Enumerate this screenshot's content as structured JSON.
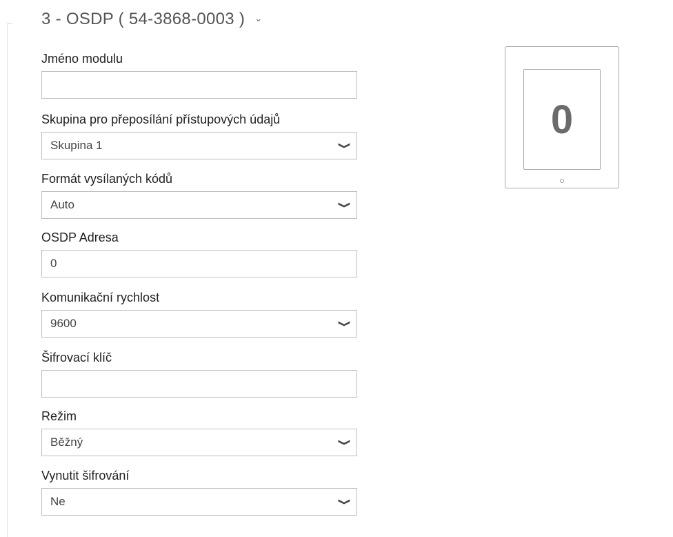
{
  "section": {
    "title": "3 - OSDP ( 54-3868-0003 )"
  },
  "fields": {
    "module_name": {
      "label": "Jméno modulu",
      "value": ""
    },
    "credential_group": {
      "label": "Skupina pro přeposílání přístupových údajů",
      "value": "Skupina 1"
    },
    "code_format": {
      "label": "Formát vysílaných kódů",
      "value": "Auto"
    },
    "osdp_address": {
      "label": "OSDP Adresa",
      "value": "0"
    },
    "baud_rate": {
      "label": "Komunikační rychlost",
      "value": "9600"
    },
    "encryption_key": {
      "label": "Šifrovací klíč",
      "value": ""
    },
    "mode": {
      "label": "Režim",
      "value": "Běžný"
    },
    "force_encryption": {
      "label": "Vynutit šifrování",
      "value": "Ne"
    }
  },
  "module_preview": {
    "address_digit": "0"
  }
}
